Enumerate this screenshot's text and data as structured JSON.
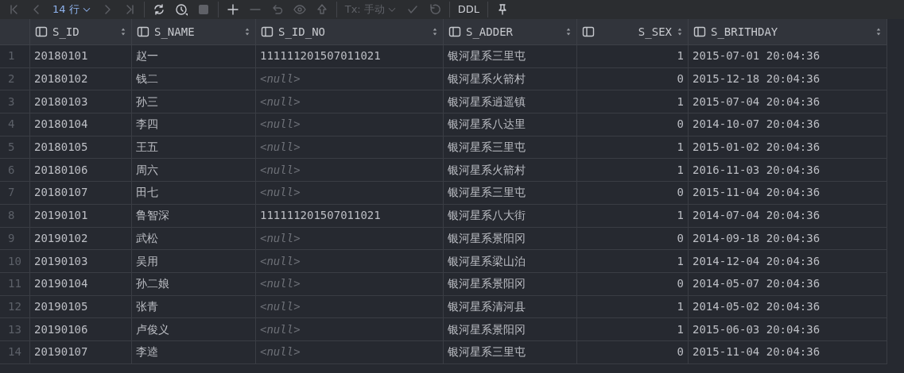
{
  "toolbar": [
    {
      "kind": "first",
      "disabled": true
    },
    {
      "kind": "prev",
      "disabled": true
    },
    {
      "kind": "rows",
      "label": "14 行",
      "disabled": false
    },
    {
      "kind": "next",
      "disabled": true
    },
    {
      "kind": "last",
      "disabled": true
    },
    {
      "kind": "sep"
    },
    {
      "kind": "refresh",
      "disabled": false
    },
    {
      "kind": "history",
      "disabled": false
    },
    {
      "kind": "stop",
      "disabled": true
    },
    {
      "kind": "sep"
    },
    {
      "kind": "add",
      "disabled": false
    },
    {
      "kind": "remove",
      "disabled": true
    },
    {
      "kind": "undo",
      "disabled": true
    },
    {
      "kind": "preview",
      "disabled": true
    },
    {
      "kind": "submit",
      "disabled": true
    },
    {
      "kind": "sep"
    },
    {
      "kind": "tx",
      "label": "Tx: 手动",
      "disabled": true
    },
    {
      "kind": "commit",
      "disabled": true
    },
    {
      "kind": "rollback",
      "disabled": true
    },
    {
      "kind": "sep"
    },
    {
      "kind": "ddl",
      "label": "DDL",
      "disabled": false
    },
    {
      "kind": "sep"
    },
    {
      "kind": "pin",
      "disabled": false
    }
  ],
  "table": {
    "columns": [
      {
        "name": "S_ID",
        "kind": "text"
      },
      {
        "name": "S_NAME",
        "kind": "text"
      },
      {
        "name": "S_ID_NO",
        "kind": "text"
      },
      {
        "name": "S_ADDER",
        "kind": "text"
      },
      {
        "name": "S_SEX",
        "kind": "number"
      },
      {
        "name": "S_BRITHDAY",
        "kind": "text"
      }
    ],
    "rows": [
      {
        "number": "1",
        "cells": [
          "20180101",
          "赵一",
          {
            "text": "111111201507011021",
            "null": false
          },
          "银河星系三里屯",
          "1",
          "2015-07-01 20:04:36"
        ]
      },
      {
        "number": "2",
        "cells": [
          "20180102",
          "钱二",
          {
            "text": "<null>",
            "null": true
          },
          "银河星系火箭村",
          "0",
          "2015-12-18 20:04:36"
        ]
      },
      {
        "number": "3",
        "cells": [
          "20180103",
          "孙三",
          {
            "text": "<null>",
            "null": true
          },
          "银河星系逍遥镇",
          "1",
          "2015-07-04 20:04:36"
        ]
      },
      {
        "number": "4",
        "cells": [
          "20180104",
          "李四",
          {
            "text": "<null>",
            "null": true
          },
          "银河星系八达里",
          "0",
          "2014-10-07 20:04:36"
        ]
      },
      {
        "number": "5",
        "cells": [
          "20180105",
          "王五",
          {
            "text": "<null>",
            "null": true
          },
          "银河星系三里屯",
          "1",
          "2015-01-02 20:04:36"
        ]
      },
      {
        "number": "6",
        "cells": [
          "20180106",
          "周六",
          {
            "text": "<null>",
            "null": true
          },
          "银河星系火箭村",
          "1",
          "2016-11-03 20:04:36"
        ]
      },
      {
        "number": "7",
        "cells": [
          "20180107",
          "田七",
          {
            "text": "<null>",
            "null": true
          },
          "银河星系三里屯",
          "0",
          "2015-11-04 20:04:36"
        ]
      },
      {
        "number": "8",
        "cells": [
          "20190101",
          "鲁智深",
          {
            "text": "111111201507011021",
            "null": false
          },
          "银河星系八大街",
          "1",
          "2014-07-04 20:04:36"
        ]
      },
      {
        "number": "9",
        "cells": [
          "20190102",
          "武松",
          {
            "text": "<null>",
            "null": true
          },
          "银河星系景阳冈",
          "0",
          "2014-09-18 20:04:36"
        ]
      },
      {
        "number": "10",
        "cells": [
          "20190103",
          "吴用",
          {
            "text": "<null>",
            "null": true
          },
          "银河星系梁山泊",
          "1",
          "2014-12-04 20:04:36"
        ]
      },
      {
        "number": "11",
        "cells": [
          "20190104",
          "孙二娘",
          {
            "text": "<null>",
            "null": true
          },
          "银河星系景阳冈",
          "0",
          "2014-05-07 20:04:36"
        ]
      },
      {
        "number": "12",
        "cells": [
          "20190105",
          "张青",
          {
            "text": "<null>",
            "null": true
          },
          "银河星系清河县",
          "1",
          "2014-05-02 20:04:36"
        ]
      },
      {
        "number": "13",
        "cells": [
          "20190106",
          "卢俊义",
          {
            "text": "<null>",
            "null": true
          },
          "银河星系景阳冈",
          "1",
          "2015-06-03 20:04:36"
        ]
      },
      {
        "number": "14",
        "cells": [
          "20190107",
          "李逵",
          {
            "text": "<null>",
            "null": true
          },
          "银河星系三里屯",
          "0",
          "2015-11-04 20:04:36"
        ]
      }
    ]
  }
}
